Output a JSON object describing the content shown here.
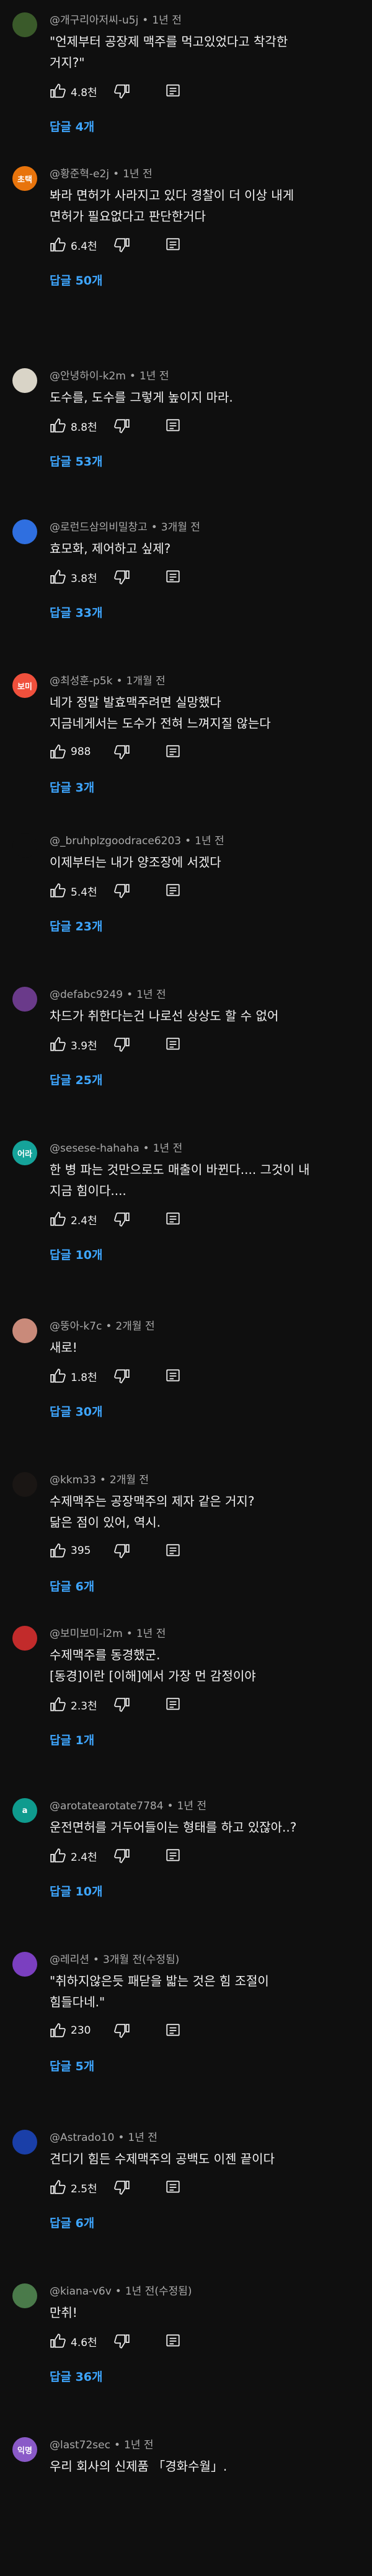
{
  "comments": [
    {
      "avatar_text": "",
      "avatar_color": "#3a5a2a",
      "author": "@개구리아저씨-u5j",
      "time": "1년 전",
      "lines": [
        "\"언제부터 공장제 맥주를 먹고있었다고 착각한",
        "거지?\""
      ],
      "likes": "4.8천",
      "replies": "답글 4개"
    },
    {
      "avatar_text": "초택",
      "avatar_color": "#e8740c",
      "author": "@황준혁-e2j",
      "time": "1년 전",
      "lines": [
        "봐라 면허가 사라지고 있다 경찰이 더 이상 내게",
        "면허가 필요없다고 판단한거다"
      ],
      "likes": "6.4천",
      "replies": "답글 50개"
    },
    {
      "avatar_text": "",
      "avatar_color": "#d9d4c7",
      "author": "@안녕하이-k2m",
      "time": "1년 전",
      "lines": [
        "도수를, 도수를 그렇게 높이지 마라."
      ],
      "likes": "8.8천",
      "replies": "답글 53개"
    },
    {
      "avatar_text": "",
      "avatar_color": "#2f6fe0",
      "author": "@로런드삼의비밀창고",
      "time": "3개월 전",
      "lines": [
        "효모화, 제어하고 싶제?"
      ],
      "likes": "3.8천",
      "replies": "답글 33개"
    },
    {
      "avatar_text": "보미",
      "avatar_color": "#f0503c",
      "author": "@최성훈-p5k",
      "time": "1개월 전",
      "lines": [
        "네가 정말 발효맥주려면 실망했다",
        "지금네게서는 도수가 전혀 느껴지질 않는다"
      ],
      "likes": "988",
      "replies": "답글 3개"
    },
    {
      "avatar_text": "",
      "avatar_color": "#0f0f0f",
      "author": "@_bruhplzgoodrace6203",
      "time": "1년 전",
      "lines": [
        "이제부터는 내가 양조장에 서겠다"
      ],
      "likes": "5.4천",
      "replies": "답글 23개"
    },
    {
      "avatar_text": "",
      "avatar_color": "#6a3a8a",
      "author": "@defabc9249",
      "time": "1년 전",
      "lines": [
        "차드가 취한다는건 나로선 상상도 할 수 없어"
      ],
      "likes": "3.9천",
      "replies": "답글 25개"
    },
    {
      "avatar_text": "어라",
      "avatar_color": "#15a39a",
      "author": "@sesese-hahaha",
      "time": "1년 전",
      "lines": [
        "한 병 파는 것만으로도 매출이 바뀐다.... 그것이 내",
        "지금 힘이다...."
      ],
      "likes": "2.4천",
      "replies": "답글 10개"
    },
    {
      "avatar_text": "",
      "avatar_color": "#c98a7a",
      "author": "@뚱아-k7c",
      "time": "2개월 전",
      "lines": [
        "새로!"
      ],
      "likes": "1.8천",
      "replies": "답글 30개"
    },
    {
      "avatar_text": "",
      "avatar_color": "#1a1614",
      "author": "@kkm33",
      "time": "2개월 전",
      "lines": [
        "수제맥주는 공장맥주의 제자 같은 거지?",
        "닮은 점이 있어, 역시."
      ],
      "likes": "395",
      "replies": "답글 6개"
    },
    {
      "avatar_text": "",
      "avatar_color": "#c22b2b",
      "author": "@보미보미-i2m",
      "time": "1년 전",
      "lines": [
        "수제맥주를 동경했군.",
        "[동경]이란 [이해]에서 가장 먼 감정이야"
      ],
      "likes": "2.3천",
      "replies": "답글 1개"
    },
    {
      "avatar_text": "a",
      "avatar_color": "#0f9b8e",
      "author": "@arotatearotate7784",
      "time": "1년 전",
      "lines": [
        "운전면허를 거두어들이는 형태를 하고 있잖아..?"
      ],
      "likes": "2.4천",
      "replies": "답글 10개"
    },
    {
      "avatar_text": "",
      "avatar_color": "#7b3fc0",
      "author": "@레리션",
      "time": "3개월 전(수정됨)",
      "lines": [
        "\"취하지않은듯 패닫을 밟는 것은 힘 조절이",
        "힘들다네.\""
      ],
      "likes": "230",
      "replies": "답글 5개"
    },
    {
      "avatar_text": "",
      "avatar_color": "#1a3fa8",
      "author": "@Astrado10",
      "time": "1년 전",
      "lines": [
        "견디기 힘든 수제맥주의 공백도 이젠 끝이다"
      ],
      "likes": "2.5천",
      "replies": "답글 6개"
    },
    {
      "avatar_text": "",
      "avatar_color": "#4a7a4a",
      "author": "@kiana-v6v",
      "time": "1년 전(수정됨)",
      "lines": [
        "만취!"
      ],
      "likes": "4.6천",
      "replies": "답글 36개"
    },
    {
      "avatar_text": "익명",
      "avatar_color": "#8a5ac8",
      "author": "@last72sec",
      "time": "1년 전",
      "lines": [
        "우리 회사의 신제품 「경화수월」."
      ],
      "likes": "",
      "replies": ""
    }
  ],
  "colors": {
    "reply_link": "#3ea6ff",
    "meta": "#aaaaaa"
  },
  "icons": {
    "like": "thumb-up-icon",
    "dislike": "thumb-down-icon",
    "reply": "reply-icon"
  }
}
